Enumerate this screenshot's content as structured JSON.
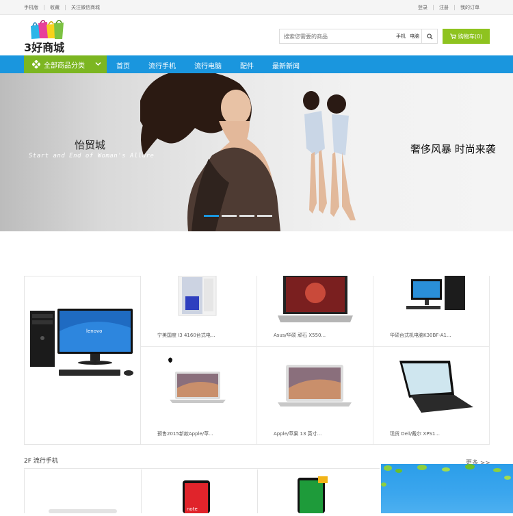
{
  "topbar": {
    "links_left": [
      "手机版",
      "收藏",
      "关注微信商城"
    ],
    "links_right": [
      "登录",
      "注册",
      "我的订单"
    ]
  },
  "header": {
    "logo_text": "3好商城",
    "search_placeholder": "搜索您需要的商品",
    "hot_keywords": [
      "手机",
      "电脑"
    ],
    "cart_label": "购物车(0)"
  },
  "nav": {
    "all_categories": "全部商品分类",
    "items": [
      "首页",
      "流行手机",
      "流行电脑",
      "配件",
      "最新新闻"
    ]
  },
  "banner": {
    "title_cn": "怡贸城",
    "subtitle_en": "Start and End of Woman's Allure",
    "slogan": "奢侈风暴 时尚来袭",
    "slide_count": 4,
    "active_slide": 1
  },
  "floor1": {
    "products": [
      "宁美国度 I3 4160台式电...",
      "Asus/华硕 顽石 X550...",
      "华硕台式机电脑K30BF-A1...",
      "预售2015新款Apple/苹...",
      "Apple/苹果 13 英寸...",
      "现货 Dell/戴尔 XPS1..."
    ]
  },
  "floor2": {
    "title": "2F 流行手机",
    "more_label": "更多 >>"
  },
  "colors": {
    "nav_blue": "#1a96de",
    "accent_green": "#7cb621",
    "cart_green": "#8ec31f"
  }
}
